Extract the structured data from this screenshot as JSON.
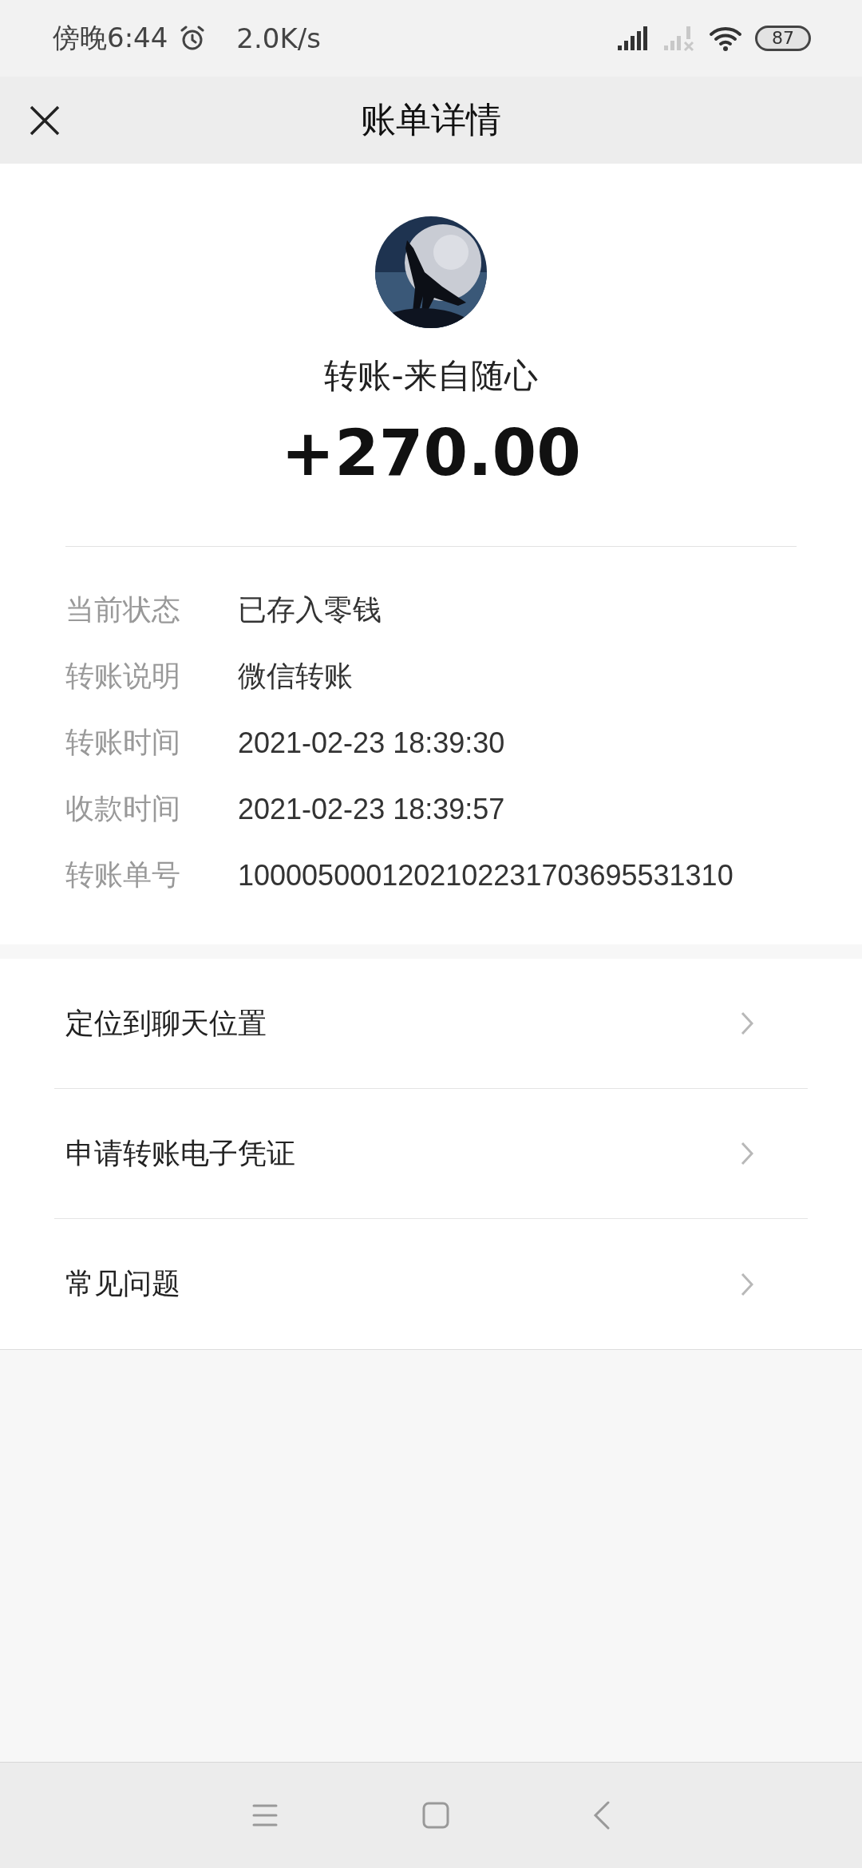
{
  "status_bar": {
    "time": "傍晚6:44",
    "speed": "2.0K/s",
    "battery": "87"
  },
  "header": {
    "title": "账单详情"
  },
  "payment": {
    "title": "转账-来自随心",
    "amount": "+270.00"
  },
  "details": [
    {
      "label": "当前状态",
      "value": "已存入零钱"
    },
    {
      "label": "转账说明",
      "value": "微信转账"
    },
    {
      "label": "转账时间",
      "value": "2021-02-23 18:39:30"
    },
    {
      "label": "收款时间",
      "value": "2021-02-23 18:39:57"
    },
    {
      "label": "转账单号",
      "value": "1000050001202102231703695531310"
    }
  ],
  "actions": [
    {
      "label": "定位到聊天位置"
    },
    {
      "label": "申请转账电子凭证"
    },
    {
      "label": "常见问题"
    }
  ]
}
